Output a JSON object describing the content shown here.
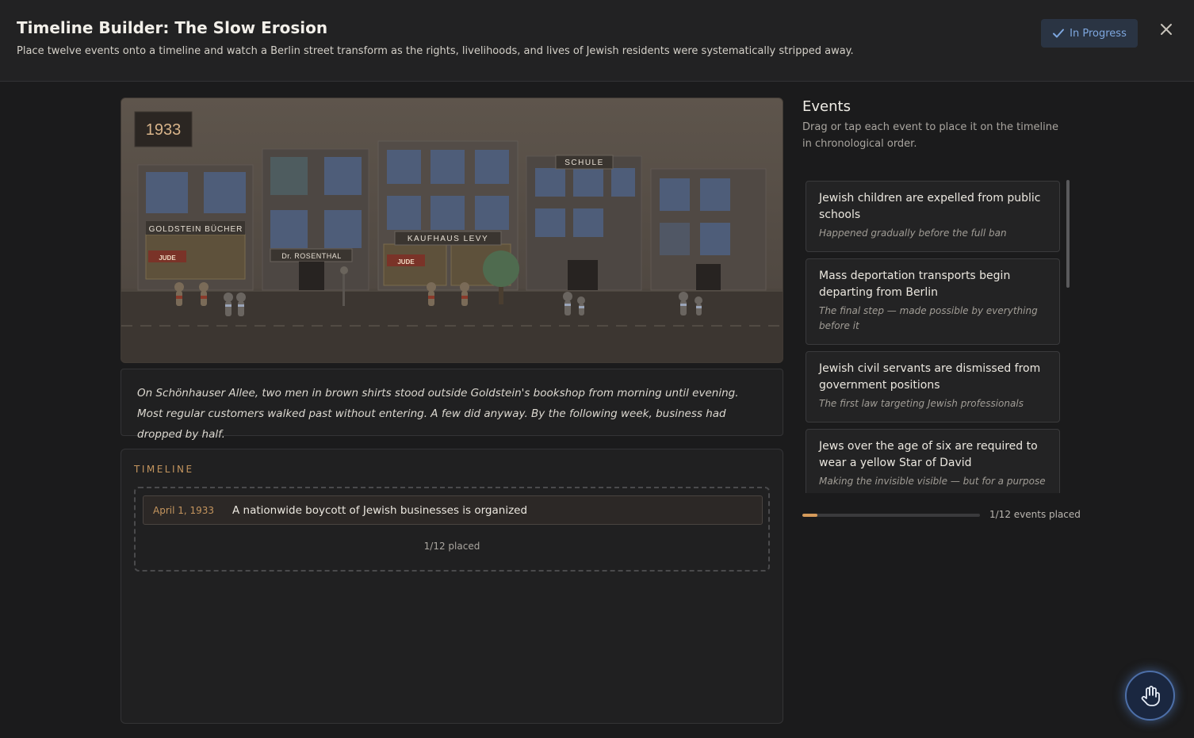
{
  "header": {
    "title": "Timeline Builder: The Slow Erosion",
    "subtitle": "Place twelve events onto a timeline and watch a Berlin street transform as the rights, livelihoods, and lives of Jewish residents were systematically stripped away.",
    "status": "In Progress"
  },
  "scene": {
    "year": "1933",
    "signs": {
      "bookshop": "GOLDSTEIN BÜCHER",
      "jude_1": "JUDE",
      "doctor": "Dr. ROSENTHAL",
      "department": "KAUFHAUS LEVY",
      "jude_2": "JUDE",
      "school": "SCHULE"
    }
  },
  "narrative": "On Schönhauser Allee, two men in brown shirts stood outside Goldstein's bookshop from morning until evening. Most regular customers walked past without entering. A few did anyway. By the following week, business had dropped by half.",
  "timeline": {
    "label": "TIMELINE",
    "placed": [
      {
        "date": "April 1, 1933",
        "text": "A nationwide boycott of Jewish businesses is organized"
      }
    ],
    "count": "1/12 placed"
  },
  "events": {
    "title": "Events",
    "description": "Drag or tap each event to place it on the timeline in chronological order.",
    "items": [
      {
        "title": "Jewish children are expelled from public schools",
        "hint": "Happened gradually before the full ban"
      },
      {
        "title": "Mass deportation transports begin departing from Berlin",
        "hint": "The final step — made possible by everything before it"
      },
      {
        "title": "Jewish civil servants are dismissed from government positions",
        "hint": "The first law targeting Jewish professionals"
      },
      {
        "title": "Jews over the age of six are required to wear a yellow Star of David",
        "hint": "Making the invisible visible — but for a purpose"
      }
    ],
    "progress_fraction": 0.0833,
    "progress_label": "1/12 events placed"
  },
  "colors": {
    "accent": "#c4955e",
    "status_text": "#7ea7df",
    "progress_fill": "#d59a5a"
  },
  "icons": {
    "status": "check-icon",
    "close": "close-icon",
    "fab": "hand-icon"
  }
}
